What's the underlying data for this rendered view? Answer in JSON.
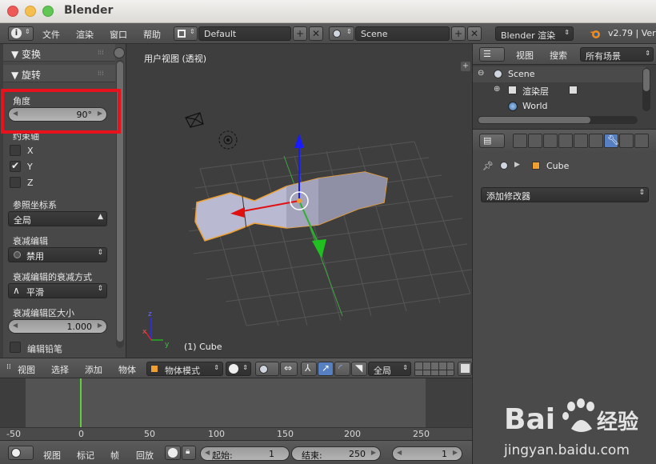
{
  "window": {
    "title": "Blender"
  },
  "info_header": {
    "menus": [
      "文件",
      "渲染",
      "窗口",
      "帮助"
    ],
    "screen_layout": "Default",
    "scene": "Scene",
    "render_engine": "Blender 渲染",
    "version": "v2.79 | Ver"
  },
  "tool_panel": {
    "transform_header": "变换",
    "rotate_header": "旋转",
    "angle_label": "角度",
    "angle_value": "90°",
    "constraint_label": "约束轴",
    "axes": [
      {
        "label": "X",
        "checked": false
      },
      {
        "label": "Y",
        "checked": true
      },
      {
        "label": "Z",
        "checked": false
      }
    ],
    "orientation_label": "参照坐标系",
    "orientation_value": "全局",
    "proportional_label": "衰减编辑",
    "proportional_value": "禁用",
    "falloff_label": "衰减编辑的衰减方式",
    "falloff_value": "平滑",
    "size_label": "衰减编辑区大小",
    "size_value": "1.000",
    "grease_pencil_label": "编辑铅笔"
  },
  "viewport": {
    "view_label": "用户视图 (透视)",
    "object_label": "(1) Cube",
    "axis_labels": {
      "x": "x",
      "y": "y",
      "z": "z"
    }
  },
  "viewport_header": {
    "menus": [
      "视图",
      "选择",
      "添加",
      "物体"
    ],
    "mode": "物体模式",
    "orientation": "全局"
  },
  "timeline": {
    "ruler_ticks": [
      "-50",
      "0",
      "50",
      "100",
      "150",
      "200",
      "250"
    ],
    "current_frame_marker": 0
  },
  "timeline_header": {
    "menus": [
      "视图",
      "标记",
      "帧",
      "回放"
    ],
    "start_label": "起始:",
    "start_value": "1",
    "end_label": "结束:",
    "end_value": "250",
    "current_frame": "1"
  },
  "outliner": {
    "menus": [
      "视图",
      "搜索"
    ],
    "filter": "所有场景",
    "items": [
      {
        "label": "Scene",
        "indent": 0
      },
      {
        "label": "渲染层",
        "indent": 1
      },
      {
        "label": "World",
        "indent": 1
      }
    ]
  },
  "properties": {
    "object_name": "Cube",
    "add_modifier": "添加修改器"
  },
  "watermark": {
    "brand": "Bai",
    "brand_cn": "经验",
    "url": "jingyan.baidu.com"
  },
  "colors": {
    "accent_red": "#e8121d",
    "frame_cursor": "#5fd038",
    "selection_orange": "#f0a030"
  }
}
